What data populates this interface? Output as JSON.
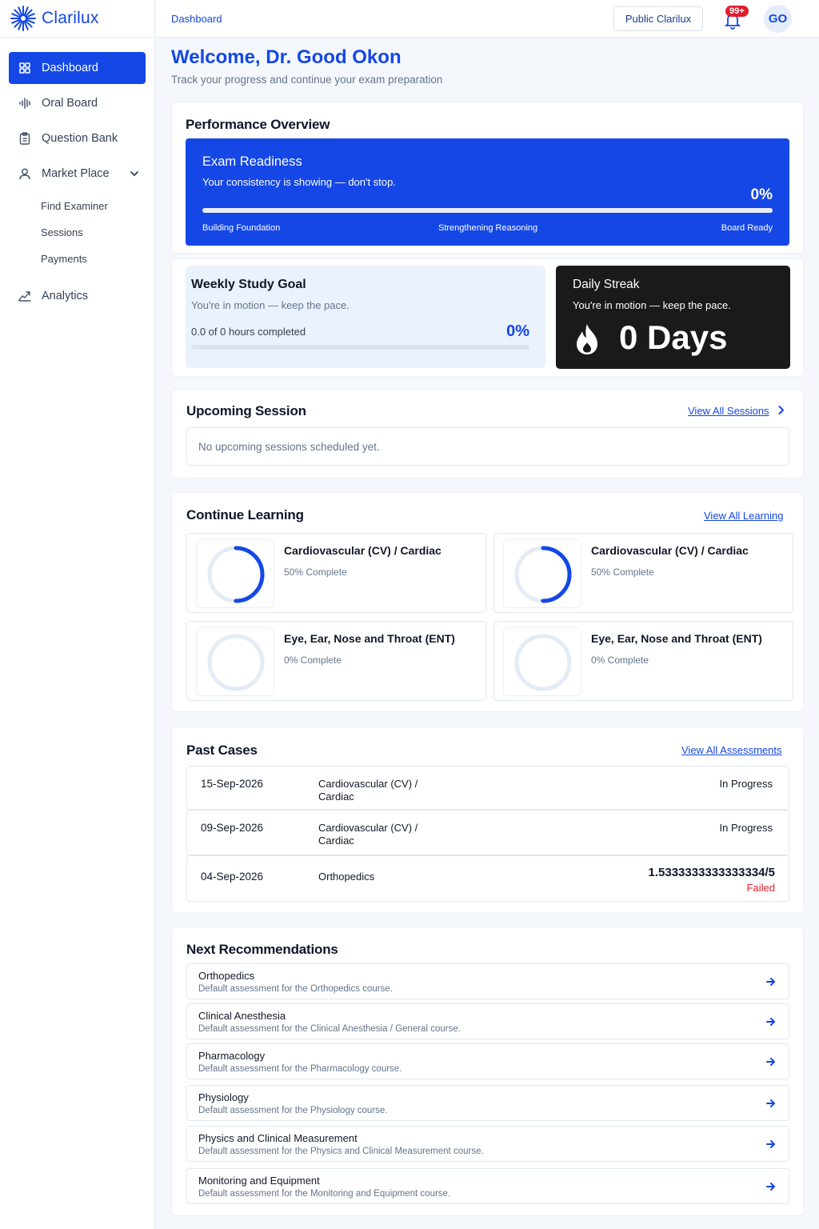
{
  "app": {
    "name": "Clarilux"
  },
  "sidebar": {
    "items": [
      {
        "label": "Dashboard",
        "icon": "grid-icon"
      },
      {
        "label": "Oral Board",
        "icon": "waveform-icon"
      },
      {
        "label": "Question Bank",
        "icon": "clipboard-icon"
      },
      {
        "label": "Market Place",
        "icon": "user-icon"
      },
      {
        "label": "Analytics",
        "icon": "chart-line-icon"
      }
    ],
    "marketplace_sub": [
      "Find Examiner",
      "Sessions",
      "Payments"
    ]
  },
  "header": {
    "breadcrumb": "Dashboard",
    "public_button": "Public Clarilux",
    "notification_count": "99+",
    "avatar_initials": "GO"
  },
  "welcome": {
    "title": "Welcome, Dr. Good Okon",
    "subtitle": "Track your progress and continue your exam preparation"
  },
  "performance": {
    "title": "Performance Overview",
    "readiness": {
      "title": "Exam Readiness",
      "subtitle": "Your consistency is showing — don't stop.",
      "percent": "0%",
      "progress": 0,
      "stages": [
        "Building Foundation",
        "Strengthening Reasoning",
        "Board Ready"
      ]
    },
    "weekly": {
      "title": "Weekly Study Goal",
      "subtitle": "You're in motion — keep the pace.",
      "hours": "0.0 of 0 hours completed",
      "percent": "0%",
      "progress": 0
    },
    "streak": {
      "title": "Daily Streak",
      "subtitle": "You're in motion — keep the pace.",
      "days": "0 Days"
    }
  },
  "upcoming": {
    "title": "Upcoming Session",
    "link": "View All Sessions",
    "empty": "No upcoming sessions scheduled yet."
  },
  "learning": {
    "title": "Continue Learning",
    "link": "View All Learning",
    "courses": [
      {
        "name": "Cardiovascular (CV) / Cardiac",
        "progress_text": "50% Complete",
        "progress": 0.5
      },
      {
        "name": "Cardiovascular (CV) / Cardiac",
        "progress_text": "50% Complete",
        "progress": 0.5
      },
      {
        "name": "Eye, Ear, Nose and Throat (ENT)",
        "progress_text": "0% Complete",
        "progress": 0
      },
      {
        "name": "Eye, Ear, Nose and Throat (ENT)",
        "progress_text": "0% Complete",
        "progress": 0
      }
    ]
  },
  "cases": {
    "title": "Past Cases",
    "link": "View All Assessments",
    "rows": [
      {
        "date": "15-Sep-2026",
        "course": "Cardiovascular (CV) / Cardiac",
        "status": "In Progress"
      },
      {
        "date": "09-Sep-2026",
        "course": "Cardiovascular (CV) / Cardiac",
        "status": "In Progress"
      },
      {
        "date": "04-Sep-2026",
        "course": "Orthopedics",
        "score": "1.5333333333333334/5",
        "result": "Failed"
      }
    ]
  },
  "recommendations": {
    "title": "Next Recommendations",
    "items": [
      {
        "title": "Orthopedics",
        "desc": "Default assessment for the Orthopedics course."
      },
      {
        "title": "Clinical Anesthesia",
        "desc": "Default assessment for the Clinical Anesthesia / General course."
      },
      {
        "title": "Pharmacology",
        "desc": "Default assessment for the Pharmacology course."
      },
      {
        "title": "Physiology",
        "desc": "Default assessment for the Physiology course."
      },
      {
        "title": "Physics and Clinical Measurement",
        "desc": "Default assessment for the Physics and Clinical Measurement course."
      },
      {
        "title": "Monitoring and Equipment",
        "desc": "Default assessment for the Monitoring and Equipment course."
      }
    ]
  },
  "colors": {
    "primary": "#1447e6",
    "danger": "#e11d2e",
    "dark": "#1a1a1a",
    "light_blue": "#eaf2fd"
  }
}
